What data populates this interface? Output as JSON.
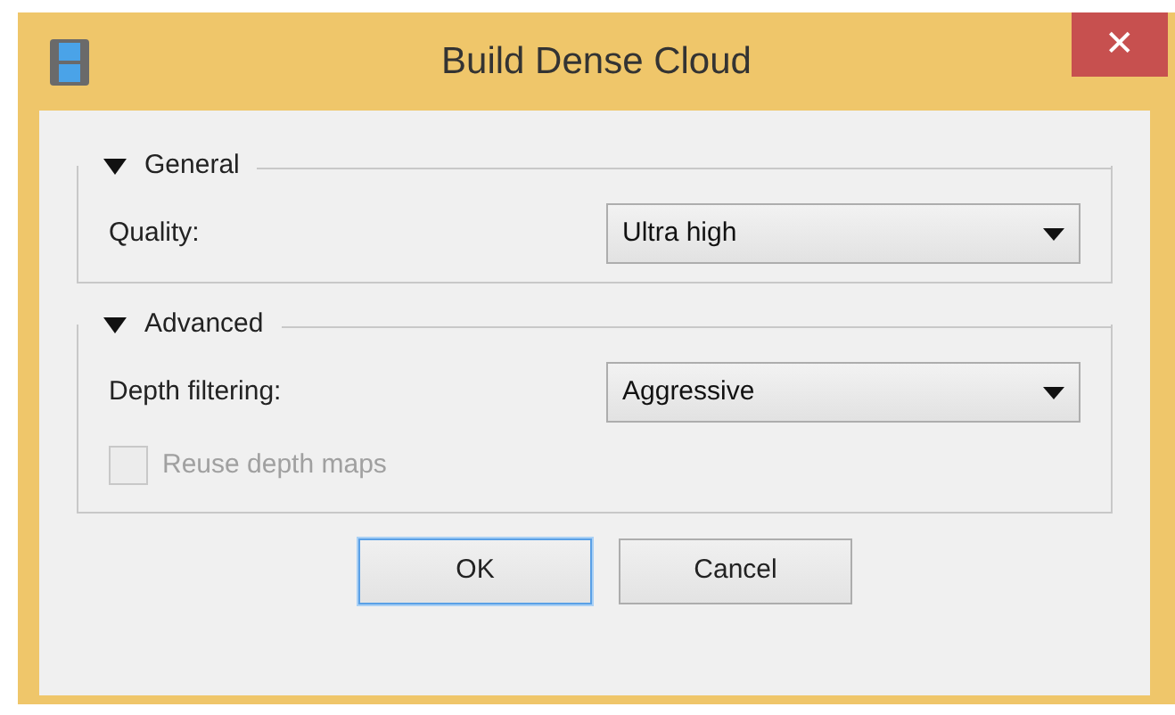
{
  "window": {
    "title": "Build Dense Cloud",
    "close": "✕"
  },
  "sections": [
    {
      "label": "General",
      "expanded": true,
      "rows": [
        {
          "kind": "select",
          "label": "Quality:",
          "value": "Ultra high"
        }
      ]
    },
    {
      "label": "Advanced",
      "expanded": true,
      "rows": [
        {
          "kind": "select",
          "label": "Depth filtering:",
          "value": "Aggressive"
        },
        {
          "kind": "checkbox",
          "label": "Reuse depth maps",
          "checked": false,
          "disabled": true
        }
      ]
    }
  ],
  "buttons": [
    {
      "label": "OK",
      "default": true
    },
    {
      "label": "Cancel",
      "default": false
    }
  ]
}
